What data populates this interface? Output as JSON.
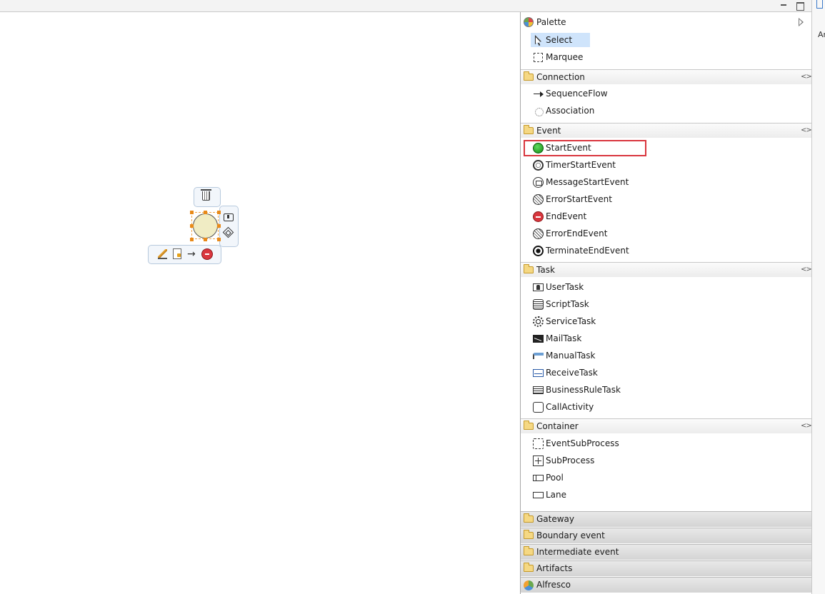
{
  "palette": {
    "title": "Palette",
    "top_items": [
      {
        "label": "Select",
        "icon": "select-arrow-icon"
      },
      {
        "label": "Marquee",
        "icon": "marquee-icon"
      }
    ],
    "drawers": [
      {
        "label": "Connection",
        "items": [
          "SequenceFlow",
          "Association"
        ]
      },
      {
        "label": "Event",
        "items": [
          "StartEvent",
          "TimerStartEvent",
          "MessageStartEvent",
          "ErrorStartEvent",
          "EndEvent",
          "ErrorEndEvent",
          "TerminateEndEvent"
        ]
      },
      {
        "label": "Task",
        "items": [
          "UserTask",
          "ScriptTask",
          "ServiceTask",
          "MailTask",
          "ManualTask",
          "ReceiveTask",
          "BusinessRuleTask",
          "CallActivity"
        ]
      },
      {
        "label": "Container",
        "items": [
          "EventSubProcess",
          "SubProcess",
          "Pool",
          "Lane"
        ]
      }
    ],
    "closed_drawers": [
      "Gateway",
      "Boundary event",
      "Intermediate event",
      "Artifacts",
      "Alfresco"
    ]
  },
  "right_strip": {
    "partial_text": "Ar"
  },
  "colors": {
    "highlight_border": "#d9363e",
    "selection_bg": "#cfe4fb",
    "start_event_fill": "#f0ecc4",
    "handle": "#e88a1a"
  }
}
